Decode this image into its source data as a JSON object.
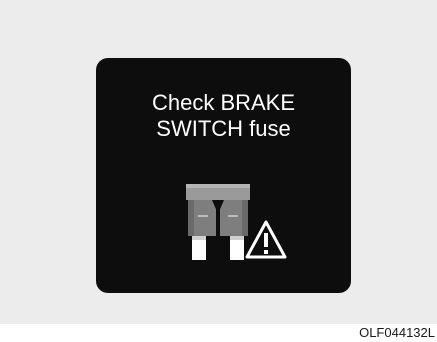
{
  "display": {
    "message_line1": "Check BRAKE",
    "message_line2": "SWITCH fuse",
    "icons": [
      "fuse-icon",
      "warning-triangle-icon"
    ]
  },
  "caption": "OLF044132L",
  "colors": {
    "panel_background": "#ececec",
    "display_background": "#0d0d0d",
    "message_text": "#ffffff",
    "fuse_body": "#8a8a8a",
    "warning_triangle": "#ffffff"
  }
}
